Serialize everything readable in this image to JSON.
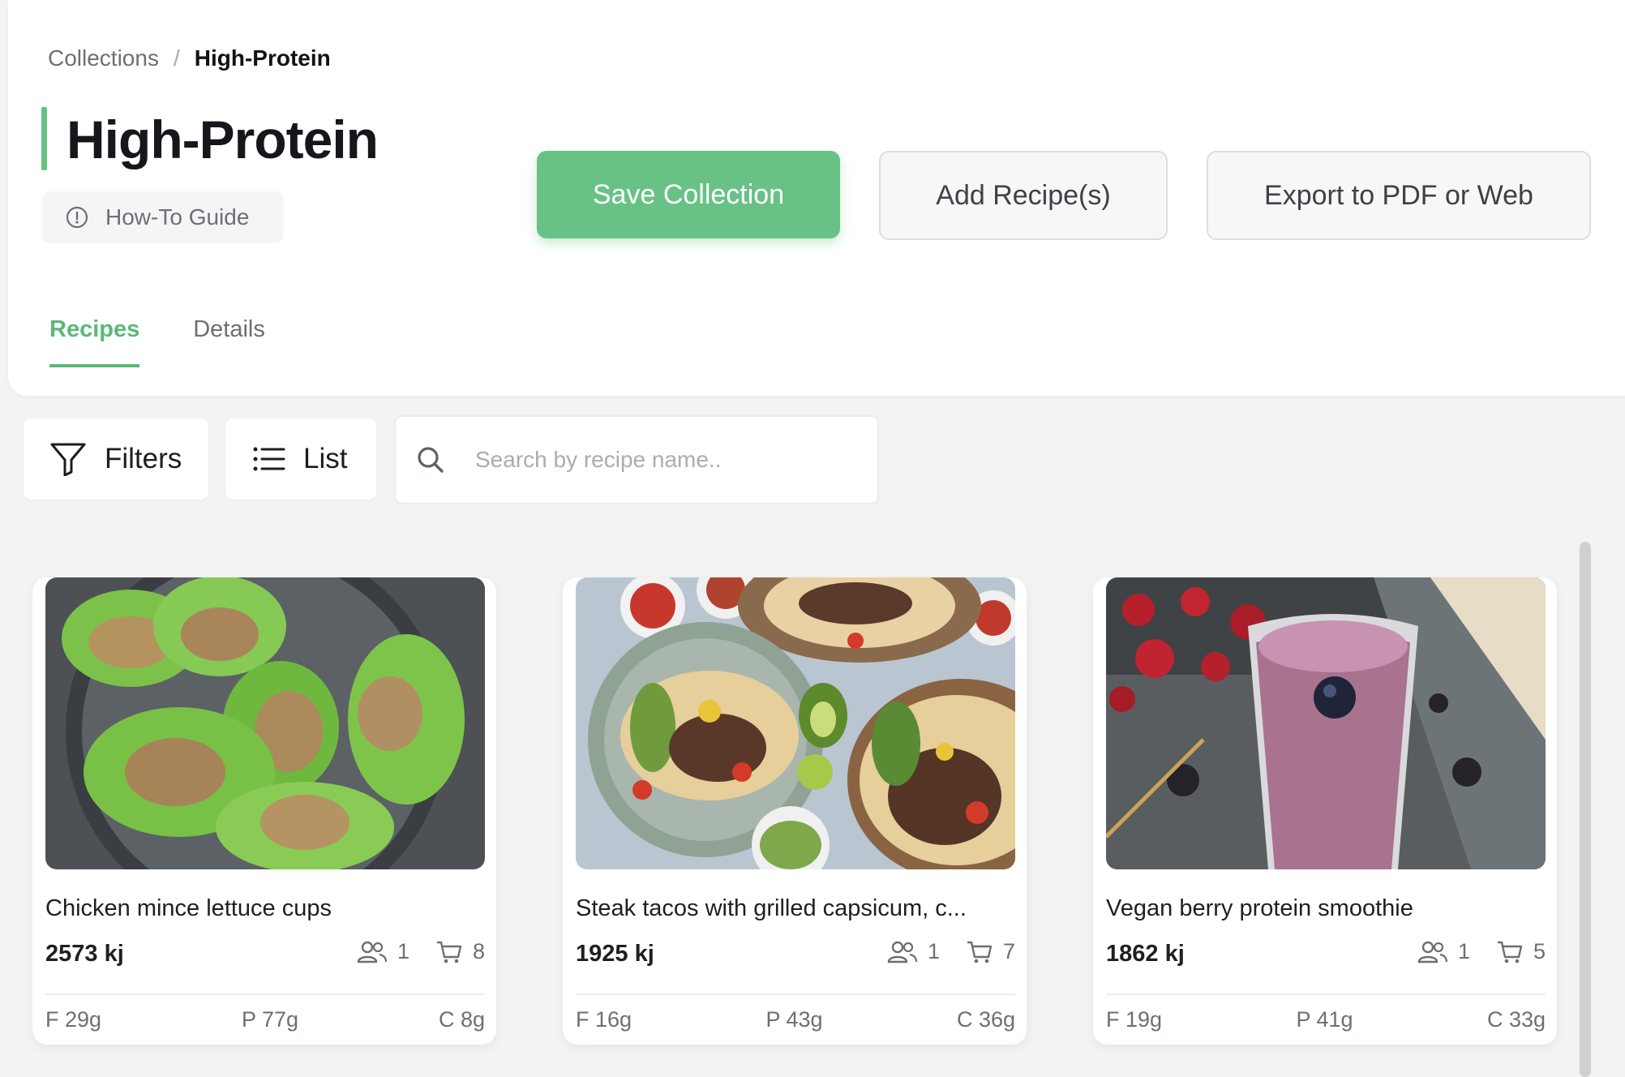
{
  "breadcrumb": {
    "parent": "Collections",
    "separator": "/",
    "current": "High-Protein"
  },
  "page": {
    "title": "High-Protein",
    "guide_label": "How-To Guide"
  },
  "actions": {
    "save": "Save Collection",
    "add": "Add Recipe(s)",
    "export": "Export to PDF or Web"
  },
  "tabs": [
    {
      "label": "Recipes",
      "active": true
    },
    {
      "label": "Details",
      "active": false
    }
  ],
  "toolbar": {
    "filters": "Filters",
    "list": "List",
    "search_placeholder": "Search by recipe name.."
  },
  "recipes": [
    {
      "title": "Chicken mince lettuce cups",
      "kj": "2573 kj",
      "servings": "1",
      "ingredients": "8",
      "fat": "F 29g",
      "protein": "P 77g",
      "carbs": "C 8g"
    },
    {
      "title": "Steak tacos with grilled capsicum, c...",
      "kj": "1925 kj",
      "servings": "1",
      "ingredients": "7",
      "fat": "F 16g",
      "protein": "P 43g",
      "carbs": "C 36g"
    },
    {
      "title": "Vegan berry protein smoothie",
      "kj": "1862 kj",
      "servings": "1",
      "ingredients": "5",
      "fat": "F 19g",
      "protein": "P 41g",
      "carbs": "C 33g"
    }
  ],
  "colors": {
    "accent": "#66c183",
    "background": "#f3f3f3",
    "text_muted": "#6b6f76"
  }
}
